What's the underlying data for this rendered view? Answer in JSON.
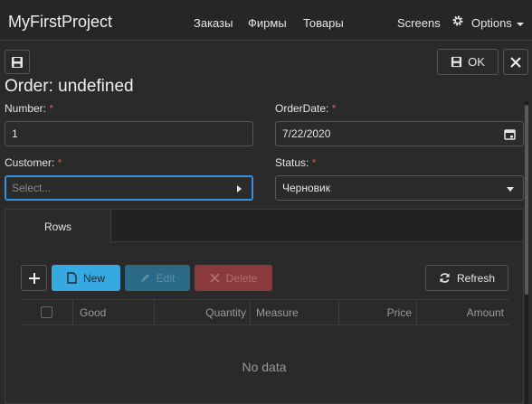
{
  "navbar": {
    "brand": "MyFirstProject",
    "links": [
      "Заказы",
      "Фирмы",
      "Товары"
    ],
    "screens": "Screens",
    "options": "Options"
  },
  "toolbar": {
    "ok_label": "OK"
  },
  "title": "Order: undefined",
  "form": {
    "number": {
      "label": "Number:",
      "required": "*",
      "value": "1"
    },
    "order_date": {
      "label": "OrderDate:",
      "required": "*",
      "value": "7/22/2020"
    },
    "customer": {
      "label": "Customer:",
      "required": "*",
      "placeholder": "Select..."
    },
    "status": {
      "label": "Status:",
      "required": "*",
      "value": "Черновик"
    }
  },
  "tabs": {
    "active": "Rows"
  },
  "grid_toolbar": {
    "new_label": "New",
    "edit_label": "Edit",
    "delete_label": "Delete",
    "refresh_label": "Refresh"
  },
  "grid": {
    "columns": [
      "Good",
      "Quantity",
      "Measure",
      "Price",
      "Amount"
    ],
    "empty_text": "No data"
  },
  "colors": {
    "primary": "#36a9e1",
    "danger": "#8a3a3a",
    "required": "#e05050",
    "background": "#2a2a2a"
  }
}
